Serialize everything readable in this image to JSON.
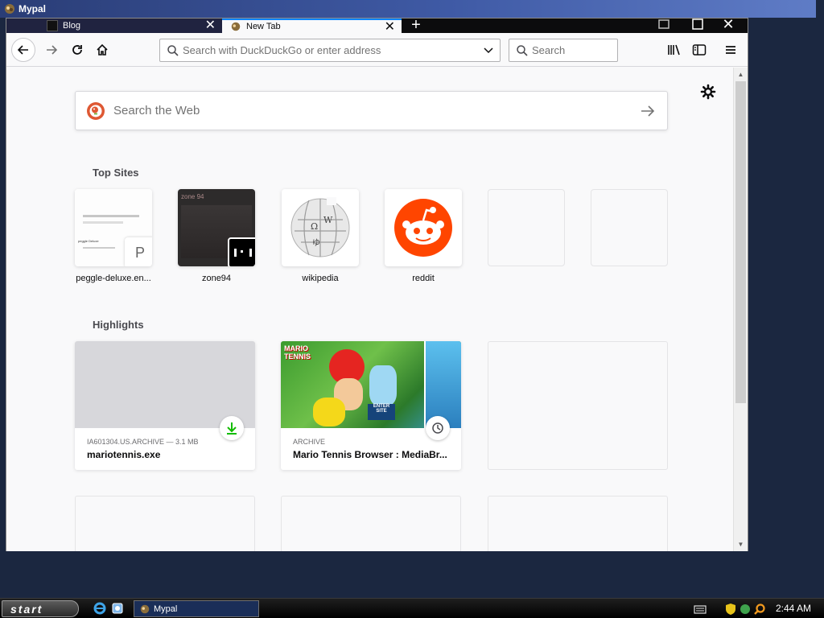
{
  "window": {
    "title": "Mypal"
  },
  "tabs": [
    {
      "label": "Blog"
    },
    {
      "label": "New Tab"
    }
  ],
  "navbar": {
    "url_placeholder": "Search with DuckDuckGo or enter address",
    "search_placeholder": "Search"
  },
  "newtab": {
    "web_search_placeholder": "Search the Web",
    "top_sites_title": "Top Sites",
    "highlights_title": "Highlights",
    "top_sites": [
      {
        "label": "peggle-deluxe.en...",
        "badge_letter": "P",
        "thumb_caption": "peggle Deluxe"
      },
      {
        "label": "zone94",
        "thumb_caption": "zone 94"
      },
      {
        "label": "wikipedia"
      },
      {
        "label": "reddit"
      }
    ],
    "highlights": [
      {
        "context": "IA601304.US.ARCHIVE — 3.1 MB",
        "title": "mariotennis.exe"
      },
      {
        "context": "ARCHIVE",
        "title": "Mario Tennis Browser : MediaBr...",
        "art_text": "MARIO TENNIS",
        "art_text2": "ENTER SITE"
      }
    ]
  },
  "taskbar": {
    "start_label": "start",
    "task_label": "Mypal",
    "clock": "2:44 AM"
  },
  "colors": {
    "accent": "#0a84ff",
    "reddit": "#ff4500",
    "ddg": "#de5833",
    "download_green": "#12bc00"
  }
}
